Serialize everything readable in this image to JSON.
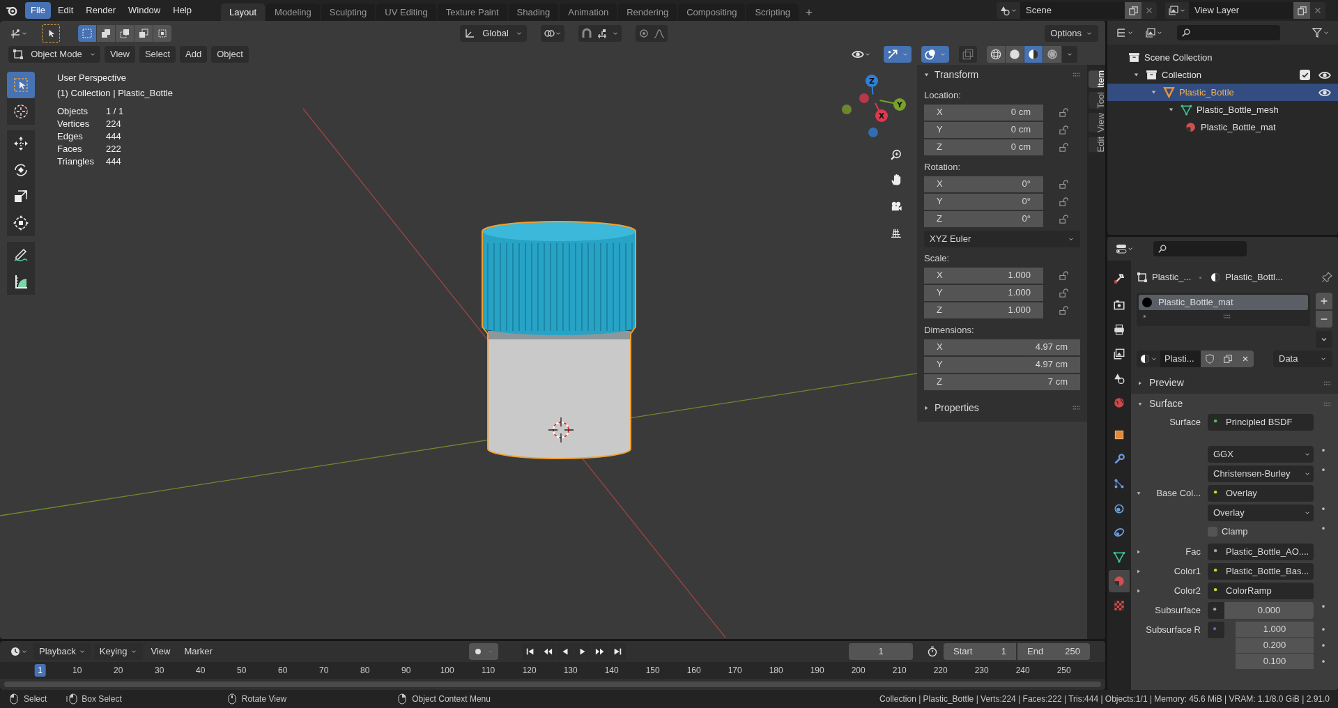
{
  "menu": [
    {
      "label": "File",
      "selected": true
    },
    {
      "label": "Edit",
      "selected": false
    },
    {
      "label": "Render",
      "selected": false
    },
    {
      "label": "Window",
      "selected": false
    },
    {
      "label": "Help",
      "selected": false
    }
  ],
  "workspaces": [
    {
      "label": "Layout",
      "selected": true
    },
    {
      "label": "Modeling",
      "selected": false
    },
    {
      "label": "Sculpting",
      "selected": false
    },
    {
      "label": "UV Editing",
      "selected": false
    },
    {
      "label": "Texture Paint",
      "selected": false
    },
    {
      "label": "Shading",
      "selected": false
    },
    {
      "label": "Animation",
      "selected": false
    },
    {
      "label": "Rendering",
      "selected": false
    },
    {
      "label": "Compositing",
      "selected": false
    },
    {
      "label": "Scripting",
      "selected": false
    }
  ],
  "add_workspace": "+",
  "scene": {
    "name": "Scene"
  },
  "view_layer": {
    "name": "View Layer"
  },
  "viewport": {
    "selection_modes": [
      {
        "kind": "new",
        "selected": true
      },
      {
        "kind": "extend",
        "selected": false
      },
      {
        "kind": "subtract",
        "selected": false
      },
      {
        "kind": "invert",
        "selected": false
      },
      {
        "kind": "intersect",
        "selected": false
      }
    ],
    "orientation": "Global",
    "options": "Options",
    "mode": "Object Mode",
    "menus": [
      "View",
      "Select",
      "Add",
      "Object"
    ],
    "toggles": [
      {
        "kind": "gizmo",
        "on": true
      },
      {
        "kind": "overlay",
        "on": true
      },
      {
        "kind": "xray",
        "on": false
      }
    ],
    "shading": [
      {
        "kind": "wireframe",
        "selected": false
      },
      {
        "kind": "solid",
        "selected": false
      },
      {
        "kind": "material",
        "selected": true
      },
      {
        "kind": "rendered",
        "selected": false
      }
    ],
    "tools": [
      {
        "kind": "select",
        "selected": true
      },
      {
        "kind": "cursor",
        "selected": false
      },
      {
        "kind": "move",
        "selected": false
      },
      {
        "kind": "rotate",
        "selected": false
      },
      {
        "kind": "scale",
        "selected": false
      },
      {
        "kind": "transform",
        "selected": false
      },
      {
        "kind": "annotate",
        "selected": false
      },
      {
        "kind": "measure",
        "selected": false
      }
    ],
    "info": {
      "title": "User Perspective",
      "context": "(1) Collection | Plastic_Bottle",
      "stats": [
        {
          "label": "Objects",
          "value": "1 / 1"
        },
        {
          "label": "Vertices",
          "value": "224"
        },
        {
          "label": "Edges",
          "value": "444"
        },
        {
          "label": "Faces",
          "value": "222"
        },
        {
          "label": "Triangles",
          "value": "444"
        }
      ]
    },
    "gizmo": [
      {
        "label": "X",
        "color": "#e0394f"
      },
      {
        "label": "Y",
        "color": "#7aa228"
      },
      {
        "label": "Z",
        "color": "#2f7fd8"
      }
    ]
  },
  "sidebar": {
    "tabs": [
      {
        "label": "Item",
        "selected": true
      },
      {
        "label": "Tool",
        "selected": false
      },
      {
        "label": "View",
        "selected": false
      },
      {
        "label": "Edit",
        "selected": false
      }
    ],
    "transform": {
      "title": "Transform",
      "expanded": true,
      "rows": [
        {
          "kind": "heading",
          "label": "Location:"
        },
        {
          "kind": "field",
          "axis": "X",
          "value": "0 cm"
        },
        {
          "kind": "field",
          "axis": "Y",
          "value": "0 cm"
        },
        {
          "kind": "field",
          "axis": "Z",
          "value": "0 cm"
        },
        {
          "kind": "heading",
          "label": "Rotation:"
        },
        {
          "kind": "field",
          "axis": "X",
          "value": "0°"
        },
        {
          "kind": "field",
          "axis": "Y",
          "value": "0°"
        },
        {
          "kind": "field",
          "axis": "Z",
          "value": "0°"
        },
        {
          "kind": "dropdown",
          "value": "XYZ Euler"
        },
        {
          "kind": "heading",
          "label": "Scale:"
        },
        {
          "kind": "field",
          "axis": "X",
          "value": "1.000"
        },
        {
          "kind": "field",
          "axis": "Y",
          "value": "1.000"
        },
        {
          "kind": "field",
          "axis": "Z",
          "value": "1.000"
        },
        {
          "kind": "heading",
          "label": "Dimensions:"
        },
        {
          "kind": "wide_field",
          "axis": "X",
          "value": "4.97 cm"
        },
        {
          "kind": "wide_field",
          "axis": "Y",
          "value": "4.97 cm"
        },
        {
          "kind": "wide_field",
          "axis": "Z",
          "value": "7 cm"
        }
      ]
    },
    "properties": {
      "title": "Properties",
      "expanded": false
    }
  },
  "outliner": {
    "tree": [
      {
        "label": "Scene Collection",
        "kind": "scene_collection",
        "selected": false,
        "children": [
          {
            "label": "Collection",
            "kind": "collection",
            "selected": false,
            "expanded": true,
            "checked": true,
            "visible": true,
            "children": [
              {
                "label": "Plastic_Bottle",
                "kind": "object",
                "selected": true,
                "expanded": true,
                "visible": true,
                "children": [
                  {
                    "label": "Plastic_Bottle_mesh",
                    "kind": "mesh",
                    "selected": false,
                    "expanded": true,
                    "children": [
                      {
                        "label": "Plastic_Bottle_mat",
                        "kind": "material",
                        "selected": false
                      }
                    ]
                  }
                ]
              }
            ]
          }
        ]
      }
    ]
  },
  "properties": {
    "tabs": [
      {
        "kind": "tool",
        "selected": false
      },
      {
        "kind": "render",
        "selected": false
      },
      {
        "kind": "output",
        "selected": false
      },
      {
        "kind": "view_layer",
        "selected": false
      },
      {
        "kind": "scene",
        "selected": false
      },
      {
        "kind": "world",
        "selected": false
      },
      {
        "kind": "object",
        "selected": false
      },
      {
        "kind": "modifiers",
        "selected": false
      },
      {
        "kind": "particles",
        "selected": false
      },
      {
        "kind": "physics",
        "selected": false
      },
      {
        "kind": "constraints",
        "selected": false
      },
      {
        "kind": "data",
        "selected": false
      },
      {
        "kind": "material",
        "selected": true
      },
      {
        "kind": "texture",
        "selected": false
      }
    ],
    "breadcrumb": [
      "Plastic_...",
      "Plastic_Bottl..."
    ],
    "slots": [
      {
        "label": "Plastic_Bottle_mat",
        "selected": true
      }
    ],
    "datablock": {
      "name": "Plasti...",
      "link": "Data"
    },
    "panels": [
      {
        "title": "Preview",
        "expanded": false
      },
      {
        "title": "Surface",
        "expanded": true
      }
    ],
    "surface_rows": [
      {
        "kind": "socket",
        "label": "Surface",
        "value": "Principled BSDF",
        "color": "#4fc14f"
      },
      {
        "kind": "dropdown",
        "value": "GGX"
      },
      {
        "kind": "dropdown",
        "value": "Christensen-Burley"
      },
      {
        "kind": "socket",
        "label": "Base Col...",
        "value": "Overlay",
        "color": "#d6d62a",
        "expanded": true
      },
      {
        "kind": "dropdown",
        "value": "Overlay"
      },
      {
        "kind": "checkbox",
        "label": "Clamp",
        "checked": false
      },
      {
        "kind": "socket",
        "label": "Fac",
        "value": "Plastic_Bottle_AO....",
        "color": "#a1a1a1",
        "expanded": false
      },
      {
        "kind": "socket",
        "label": "Color1",
        "value": "Plastic_Bottle_Bas...",
        "color": "#d6d62a",
        "expanded": false
      },
      {
        "kind": "socket",
        "label": "Color2",
        "value": "ColorRamp",
        "color": "#d6d62a",
        "expanded": false
      },
      {
        "kind": "number",
        "label": "Subsurface",
        "color": "#a1a1a1",
        "values": [
          "0.000"
        ]
      },
      {
        "kind": "number",
        "label": "Subsurface R",
        "color": "#6363c7",
        "values": [
          "1.000",
          "0.200",
          "0.100"
        ]
      }
    ]
  },
  "timeline": {
    "menus": [
      "Playback",
      "Keying",
      "View",
      "Marker"
    ],
    "current_frame": "1",
    "start": {
      "label": "Start",
      "value": "1"
    },
    "end": {
      "label": "End",
      "value": "250"
    },
    "frames": [
      {
        "label": "1",
        "current": true
      },
      {
        "label": "10",
        "current": false
      },
      {
        "label": "20",
        "current": false
      },
      {
        "label": "30",
        "current": false
      },
      {
        "label": "40",
        "current": false
      },
      {
        "label": "50",
        "current": false
      },
      {
        "label": "60",
        "current": false
      },
      {
        "label": "70",
        "current": false
      },
      {
        "label": "80",
        "current": false
      },
      {
        "label": "90",
        "current": false
      },
      {
        "label": "100",
        "current": false
      },
      {
        "label": "110",
        "current": false
      },
      {
        "label": "120",
        "current": false
      },
      {
        "label": "130",
        "current": false
      },
      {
        "label": "140",
        "current": false
      },
      {
        "label": "150",
        "current": false
      },
      {
        "label": "160",
        "current": false
      },
      {
        "label": "170",
        "current": false
      },
      {
        "label": "180",
        "current": false
      },
      {
        "label": "190",
        "current": false
      },
      {
        "label": "200",
        "current": false
      },
      {
        "label": "210",
        "current": false
      },
      {
        "label": "220",
        "current": false
      },
      {
        "label": "230",
        "current": false
      },
      {
        "label": "240",
        "current": false
      },
      {
        "label": "250",
        "current": false
      }
    ]
  },
  "status_bar": {
    "hints": [
      {
        "kind": "left",
        "label": "Select"
      },
      {
        "kind": "drag",
        "label": "Box Select"
      },
      {
        "kind": "middle",
        "label": "Rotate View"
      },
      {
        "kind": "right",
        "label": "Object Context Menu"
      }
    ],
    "stats": "Collection | Plastic_Bottle | Verts:224 | Faces:222 | Tris:444 | Objects:1/1 | Memory: 45.6 MiB | VRAM: 1.1/8.0 GiB | 2.91.0"
  }
}
